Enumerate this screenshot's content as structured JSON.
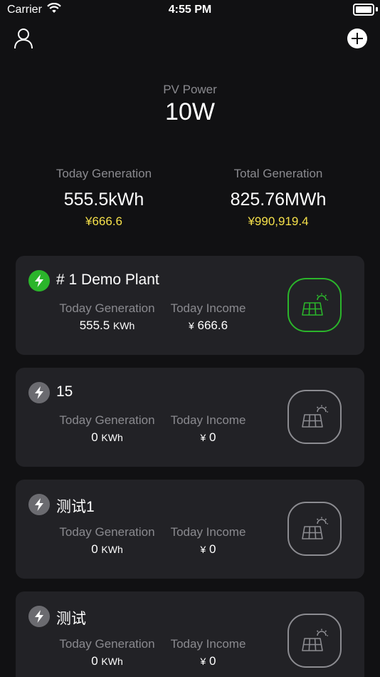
{
  "status_bar": {
    "carrier": "Carrier",
    "time": "4:55 PM"
  },
  "pv": {
    "label": "PV Power",
    "value": "10W"
  },
  "today": {
    "label": "Today Generation",
    "value": "555.5kWh",
    "income": "¥666.6"
  },
  "total": {
    "label": "Total Generation",
    "value": "825.76MWh",
    "income": "¥990,919.4"
  },
  "colors": {
    "active": "#2bb52b",
    "inactive": "#6b6b70",
    "money": "#f5e04a"
  },
  "plants": [
    {
      "name": "# 1 Demo Plant",
      "gen_label": "Today Generation",
      "gen_value": "555.5",
      "gen_unit": "KWh",
      "income_label": "Today Income",
      "currency": "¥",
      "income_value": "666.6",
      "active": true
    },
    {
      "name": "15",
      "gen_label": "Today Generation",
      "gen_value": "0",
      "gen_unit": "KWh",
      "income_label": "Today Income",
      "currency": "¥",
      "income_value": "0",
      "active": false
    },
    {
      "name": "测试1",
      "gen_label": "Today Generation",
      "gen_value": "0",
      "gen_unit": "KWh",
      "income_label": "Today Income",
      "currency": "¥",
      "income_value": "0",
      "active": false
    },
    {
      "name": "测试",
      "gen_label": "Today Generation",
      "gen_value": "0",
      "gen_unit": "KWh",
      "income_label": "Today Income",
      "currency": "¥",
      "income_value": "0",
      "active": false
    }
  ]
}
